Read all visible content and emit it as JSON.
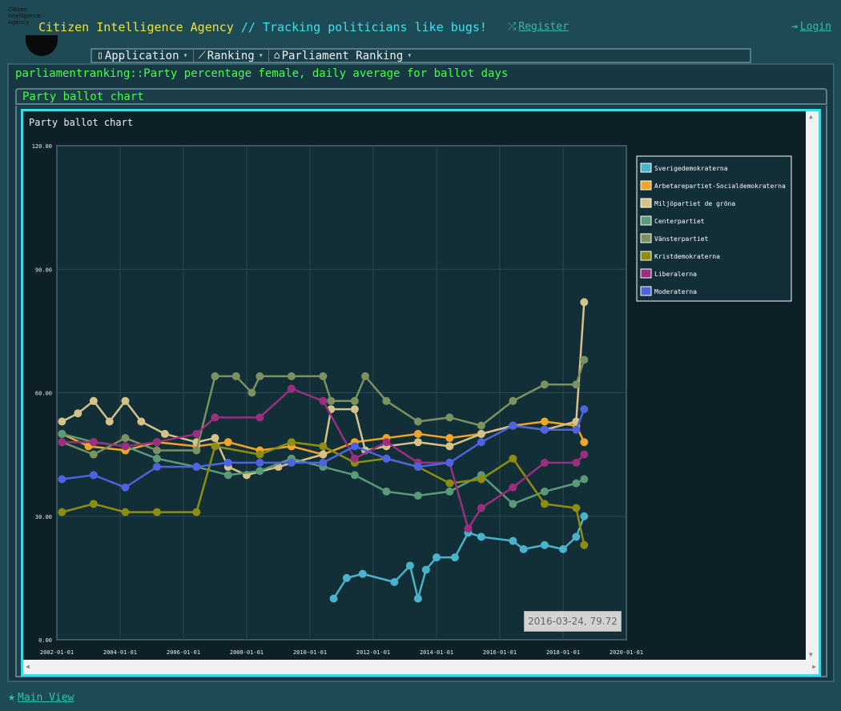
{
  "header": {
    "logo_text": "Citizen\nIntelligence\nAgency",
    "title_part1": "Citizen Intelligence Agency",
    "title_part2": " // Tracking politicians like bugs!",
    "register": "Register",
    "login": "Login",
    "register_icon": "shuffle-icon",
    "login_icon": "sign-in-icon"
  },
  "menu": [
    {
      "label": "Application",
      "icon": "mobile-icon"
    },
    {
      "label": "Ranking",
      "icon": "line-chart-icon"
    },
    {
      "label": "Parliament Ranking",
      "icon": "institution-icon"
    }
  ],
  "page_title": "parliamentranking::Party percentage female, daily average for ballot days",
  "panel_title": "Party ballot chart",
  "footer": {
    "main_view": "Main View",
    "icon": "star-icon"
  },
  "colors": {
    "Sverigedemokraterna": "#4bb3c9",
    "Arbetarepartiet-Socialdemokraterna": "#efa42a",
    "Miljöpartiet de gröna": "#d4c28a",
    "Centerpartiet": "#5a9a79",
    "Vänsterpartiet": "#7b9160",
    "Kristdemokraterna": "#8d8d11",
    "Liberalerna": "#9a2f7f",
    "Moderaterna": "#4d63e0"
  },
  "chart_data": {
    "type": "line",
    "title": "Party ballot chart",
    "xlabel": "",
    "ylabel": "",
    "x_ticks": [
      "2002-01-01",
      "2004-01-01",
      "2006-01-01",
      "2008-01-01",
      "2010-01-01",
      "2012-01-01",
      "2014-01-01",
      "2016-01-01",
      "2018-01-01",
      "2020-01-01"
    ],
    "y_ticks": [
      "0.00",
      "30.00",
      "60.00",
      "90.00",
      "120.00"
    ],
    "xlim": [
      "2002-01-01",
      "2020-01-01"
    ],
    "ylim": [
      0,
      120
    ],
    "grid": true,
    "legend_position": "top-right",
    "tooltip": "2016-03-24, 79.72",
    "series": [
      {
        "name": "Sverigedemokraterna",
        "points": [
          [
            "2010-10-01",
            10
          ],
          [
            "2011-03-01",
            15
          ],
          [
            "2011-09-01",
            16
          ],
          [
            "2012-09-01",
            14
          ],
          [
            "2013-03-01",
            18
          ],
          [
            "2013-06-01",
            10
          ],
          [
            "2013-09-01",
            17
          ],
          [
            "2014-01-01",
            20
          ],
          [
            "2014-08-01",
            20
          ],
          [
            "2015-01-01",
            26
          ],
          [
            "2015-06-01",
            25
          ],
          [
            "2016-06-01",
            24
          ],
          [
            "2016-10-01",
            22
          ],
          [
            "2017-06-01",
            23
          ],
          [
            "2018-01-01",
            22
          ],
          [
            "2018-06-01",
            25
          ],
          [
            "2018-09-01",
            30
          ]
        ]
      },
      {
        "name": "Arbetarepartiet-Socialdemokraterna",
        "points": [
          [
            "2002-03-01",
            50
          ],
          [
            "2003-01-01",
            47
          ],
          [
            "2004-03-01",
            46
          ],
          [
            "2005-03-01",
            48
          ],
          [
            "2006-06-01",
            47
          ],
          [
            "2007-06-01",
            48
          ],
          [
            "2008-06-01",
            46
          ],
          [
            "2009-06-01",
            47
          ],
          [
            "2010-06-01",
            45
          ],
          [
            "2011-06-01",
            48
          ],
          [
            "2012-06-01",
            49
          ],
          [
            "2013-06-01",
            50
          ],
          [
            "2014-06-01",
            49
          ],
          [
            "2015-06-01",
            50
          ],
          [
            "2016-06-01",
            52
          ],
          [
            "2017-06-01",
            53
          ],
          [
            "2018-06-01",
            52
          ],
          [
            "2018-09-01",
            48
          ]
        ]
      },
      {
        "name": "Miljöpartiet de gröna",
        "points": [
          [
            "2002-03-01",
            53
          ],
          [
            "2002-09-01",
            55
          ],
          [
            "2003-03-01",
            58
          ],
          [
            "2003-09-01",
            53
          ],
          [
            "2004-03-01",
            58
          ],
          [
            "2004-09-01",
            53
          ],
          [
            "2005-06-01",
            50
          ],
          [
            "2006-06-01",
            48
          ],
          [
            "2007-01-01",
            49
          ],
          [
            "2007-06-01",
            42
          ],
          [
            "2008-01-01",
            40
          ],
          [
            "2009-01-01",
            42
          ],
          [
            "2010-06-01",
            45
          ],
          [
            "2010-09-01",
            56
          ],
          [
            "2011-06-01",
            56
          ],
          [
            "2011-10-01",
            46
          ],
          [
            "2012-06-01",
            47
          ],
          [
            "2013-06-01",
            48
          ],
          [
            "2014-06-01",
            47
          ],
          [
            "2015-06-01",
            50
          ],
          [
            "2016-06-01",
            52
          ],
          [
            "2017-06-01",
            51
          ],
          [
            "2018-06-01",
            53
          ],
          [
            "2018-09-01",
            82
          ]
        ]
      },
      {
        "name": "Centerpartiet",
        "points": [
          [
            "2002-03-01",
            50
          ],
          [
            "2003-03-01",
            48
          ],
          [
            "2004-03-01",
            47
          ],
          [
            "2005-03-01",
            44
          ],
          [
            "2006-06-01",
            42
          ],
          [
            "2007-06-01",
            40
          ],
          [
            "2008-06-01",
            41
          ],
          [
            "2009-06-01",
            44
          ],
          [
            "2010-06-01",
            42
          ],
          [
            "2011-06-01",
            40
          ],
          [
            "2012-06-01",
            36
          ],
          [
            "2013-06-01",
            35
          ],
          [
            "2014-06-01",
            36
          ],
          [
            "2015-06-01",
            40
          ],
          [
            "2016-06-01",
            33
          ],
          [
            "2017-06-01",
            36
          ],
          [
            "2018-06-01",
            38
          ],
          [
            "2018-09-01",
            39
          ]
        ]
      },
      {
        "name": "Vänsterpartiet",
        "points": [
          [
            "2002-03-01",
            48
          ],
          [
            "2003-03-01",
            45
          ],
          [
            "2004-03-01",
            49
          ],
          [
            "2005-03-01",
            46
          ],
          [
            "2006-06-01",
            46
          ],
          [
            "2007-01-01",
            64
          ],
          [
            "2007-09-01",
            64
          ],
          [
            "2008-03-01",
            60
          ],
          [
            "2008-06-01",
            64
          ],
          [
            "2009-06-01",
            64
          ],
          [
            "2010-06-01",
            64
          ],
          [
            "2010-09-01",
            58
          ],
          [
            "2011-06-01",
            58
          ],
          [
            "2011-10-01",
            64
          ],
          [
            "2012-06-01",
            58
          ],
          [
            "2013-06-01",
            53
          ],
          [
            "2014-06-01",
            54
          ],
          [
            "2015-06-01",
            52
          ],
          [
            "2016-06-01",
            58
          ],
          [
            "2017-06-01",
            62
          ],
          [
            "2018-06-01",
            62
          ],
          [
            "2018-09-01",
            68
          ]
        ]
      },
      {
        "name": "Kristdemokraterna",
        "points": [
          [
            "2002-03-01",
            31
          ],
          [
            "2003-03-01",
            33
          ],
          [
            "2004-03-01",
            31
          ],
          [
            "2005-03-01",
            31
          ],
          [
            "2006-06-01",
            31
          ],
          [
            "2007-01-01",
            47
          ],
          [
            "2008-06-01",
            45
          ],
          [
            "2009-06-01",
            48
          ],
          [
            "2010-06-01",
            47
          ],
          [
            "2011-06-01",
            43
          ],
          [
            "2012-06-01",
            44
          ],
          [
            "2013-06-01",
            42
          ],
          [
            "2014-06-01",
            38
          ],
          [
            "2015-06-01",
            39
          ],
          [
            "2016-06-01",
            44
          ],
          [
            "2017-06-01",
            33
          ],
          [
            "2018-06-01",
            32
          ],
          [
            "2018-09-01",
            23
          ]
        ]
      },
      {
        "name": "Liberalerna",
        "points": [
          [
            "2002-03-01",
            48
          ],
          [
            "2003-03-01",
            48
          ],
          [
            "2004-03-01",
            47
          ],
          [
            "2005-03-01",
            48
          ],
          [
            "2006-06-01",
            50
          ],
          [
            "2007-01-01",
            54
          ],
          [
            "2008-06-01",
            54
          ],
          [
            "2009-06-01",
            61
          ],
          [
            "2010-06-01",
            58
          ],
          [
            "2011-06-01",
            44
          ],
          [
            "2012-06-01",
            48
          ],
          [
            "2013-06-01",
            43
          ],
          [
            "2014-06-01",
            43
          ],
          [
            "2015-01-01",
            27
          ],
          [
            "2015-06-01",
            32
          ],
          [
            "2016-06-01",
            37
          ],
          [
            "2017-06-01",
            43
          ],
          [
            "2018-06-01",
            43
          ],
          [
            "2018-09-01",
            45
          ]
        ]
      },
      {
        "name": "Moderaterna",
        "points": [
          [
            "2002-03-01",
            39
          ],
          [
            "2003-03-01",
            40
          ],
          [
            "2004-03-01",
            37
          ],
          [
            "2005-03-01",
            42
          ],
          [
            "2006-06-01",
            42
          ],
          [
            "2007-06-01",
            43
          ],
          [
            "2008-06-01",
            43
          ],
          [
            "2009-06-01",
            43
          ],
          [
            "2010-06-01",
            43
          ],
          [
            "2011-06-01",
            47
          ],
          [
            "2012-06-01",
            44
          ],
          [
            "2013-06-01",
            42
          ],
          [
            "2014-06-01",
            43
          ],
          [
            "2015-06-01",
            48
          ],
          [
            "2016-06-01",
            52
          ],
          [
            "2017-06-01",
            51
          ],
          [
            "2018-06-01",
            51
          ],
          [
            "2018-09-01",
            56
          ]
        ]
      }
    ]
  }
}
